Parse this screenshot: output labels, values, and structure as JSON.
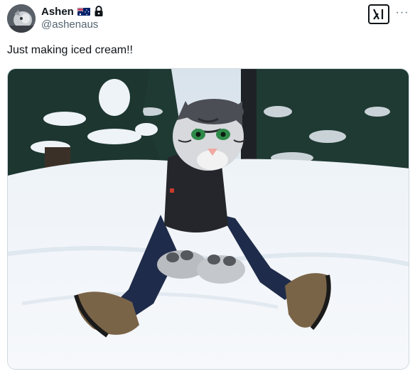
{
  "post": {
    "author": {
      "display_name": "Ashen",
      "handle": "@ashenaus",
      "flag_icon": "australia-flag-icon",
      "lock_icon": "lock-icon"
    },
    "text": "Just making iced cream!!",
    "actions": {
      "grok_icon": "grok-icon",
      "more_icon": "more-icon",
      "more_label": "···"
    },
    "media": {
      "type": "photo",
      "content": "person in grey tiger mascot head and paws sitting in snow"
    }
  },
  "colors": {
    "text_primary": "#0f1419",
    "text_secondary": "#536471",
    "border": "#cfd9de"
  }
}
